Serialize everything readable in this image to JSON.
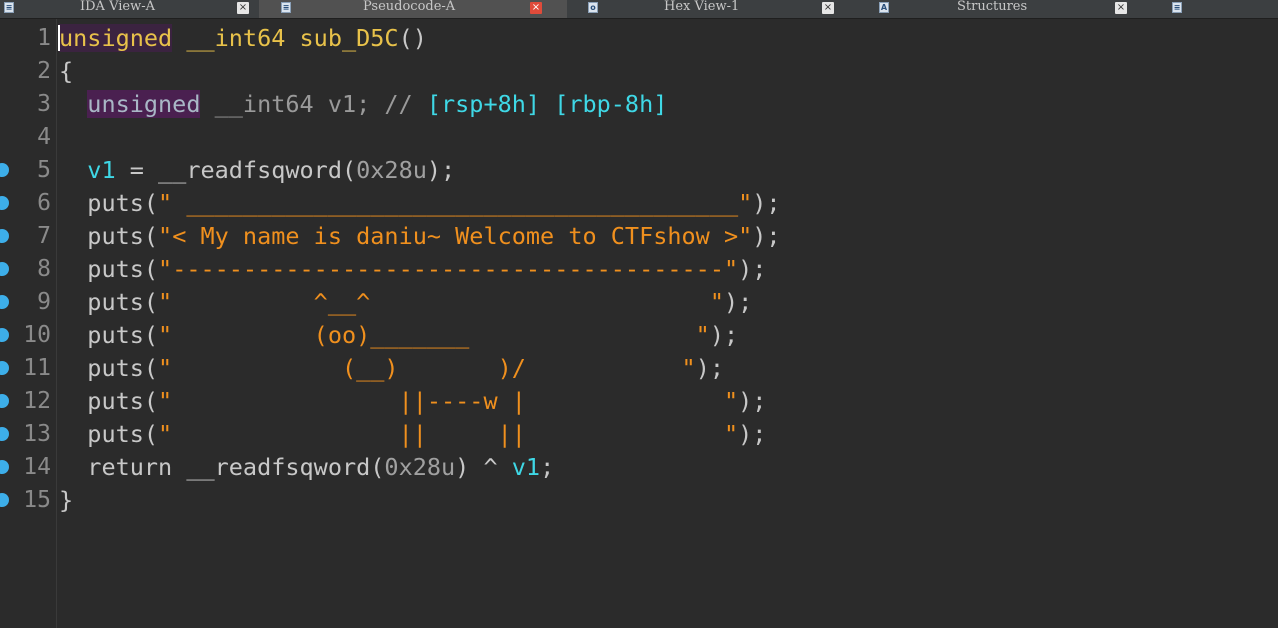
{
  "tabs": [
    {
      "label": "IDA View-A",
      "icon": "ida-view-icon",
      "active": false
    },
    {
      "label": "Pseudocode-A",
      "icon": "pseudocode-icon",
      "active": true
    },
    {
      "label": "Hex View-1",
      "icon": "hex-view-icon",
      "active": false
    },
    {
      "label": "Structures",
      "icon": "structures-icon",
      "active": false
    }
  ],
  "tab_close_glyph": "×",
  "colors": {
    "background": "#2b2b2b",
    "keyword": "#e8c24a",
    "string": "#f0901e",
    "variable": "#3fd8e6",
    "breakpoint_marker": "#3daee9"
  },
  "code_lines": [
    {
      "num": "1",
      "marker": false,
      "tokens": [
        {
          "t": "unsigned",
          "c": "kw"
        },
        {
          "t": " __int64 sub_D5C",
          "c": "fn"
        },
        {
          "t": "()",
          "c": "plain"
        }
      ]
    },
    {
      "num": "2",
      "marker": false,
      "tokens": [
        {
          "t": "{",
          "c": "plain"
        }
      ]
    },
    {
      "num": "3",
      "marker": false,
      "tokens": [
        {
          "t": "  ",
          "c": "plain"
        },
        {
          "t": "unsigned",
          "c": "kw2"
        },
        {
          "t": " __int64 v1; // ",
          "c": "cm"
        },
        {
          "t": "[rsp+8h] [rbp-8h]",
          "c": "cm2"
        }
      ]
    },
    {
      "num": "4",
      "marker": false,
      "tokens": []
    },
    {
      "num": "5",
      "marker": true,
      "tokens": [
        {
          "t": "  ",
          "c": "plain"
        },
        {
          "t": "v1",
          "c": "var"
        },
        {
          "t": " = __readfsqword(",
          "c": "plain"
        },
        {
          "t": "0x28u",
          "c": "num"
        },
        {
          "t": ");",
          "c": "plain"
        }
      ]
    },
    {
      "num": "6",
      "marker": true,
      "tokens": [
        {
          "t": "  puts(",
          "c": "plain"
        },
        {
          "t": "\" _______________________________________\"",
          "c": "str"
        },
        {
          "t": ");",
          "c": "plain"
        }
      ]
    },
    {
      "num": "7",
      "marker": true,
      "tokens": [
        {
          "t": "  puts(",
          "c": "plain"
        },
        {
          "t": "\"< My name is daniu~ Welcome to CTFshow >\"",
          "c": "str"
        },
        {
          "t": ");",
          "c": "plain"
        }
      ]
    },
    {
      "num": "8",
      "marker": true,
      "tokens": [
        {
          "t": "  puts(",
          "c": "plain"
        },
        {
          "t": "\"---------------------------------------\"",
          "c": "str"
        },
        {
          "t": ");",
          "c": "plain"
        }
      ]
    },
    {
      "num": "9",
      "marker": true,
      "tokens": [
        {
          "t": "  puts(",
          "c": "plain"
        },
        {
          "t": "\"          ^__^                        \"",
          "c": "str"
        },
        {
          "t": ");",
          "c": "plain"
        }
      ]
    },
    {
      "num": "10",
      "marker": true,
      "tokens": [
        {
          "t": "  puts(",
          "c": "plain"
        },
        {
          "t": "\"          (oo)_______                \"",
          "c": "str"
        },
        {
          "t": ");",
          "c": "plain"
        }
      ]
    },
    {
      "num": "11",
      "marker": true,
      "tokens": [
        {
          "t": "  puts(",
          "c": "plain"
        },
        {
          "t": "\"            (__)       )/           \"",
          "c": "str"
        },
        {
          "t": ");",
          "c": "plain"
        }
      ]
    },
    {
      "num": "12",
      "marker": true,
      "tokens": [
        {
          "t": "  puts(",
          "c": "plain"
        },
        {
          "t": "\"                ||----w |              \"",
          "c": "str"
        },
        {
          "t": ");",
          "c": "plain"
        }
      ]
    },
    {
      "num": "13",
      "marker": true,
      "tokens": [
        {
          "t": "  puts(",
          "c": "plain"
        },
        {
          "t": "\"                ||     ||              \"",
          "c": "str"
        },
        {
          "t": ");",
          "c": "plain"
        }
      ]
    },
    {
      "num": "14",
      "marker": true,
      "tokens": [
        {
          "t": "  return __readfsqword(",
          "c": "plain"
        },
        {
          "t": "0x28u",
          "c": "num"
        },
        {
          "t": ") ^ ",
          "c": "plain"
        },
        {
          "t": "v1",
          "c": "var"
        },
        {
          "t": ";",
          "c": "plain"
        }
      ]
    },
    {
      "num": "15",
      "marker": true,
      "tokens": [
        {
          "t": "}",
          "c": "plain"
        }
      ]
    }
  ]
}
